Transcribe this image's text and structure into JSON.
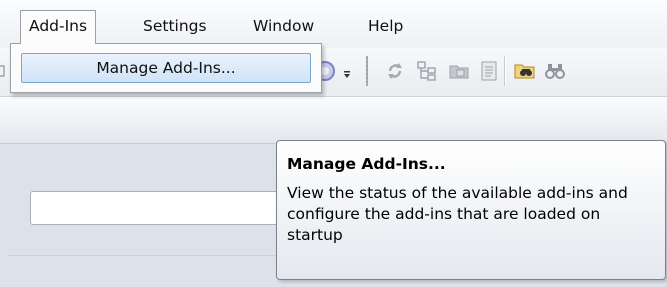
{
  "menubar": {
    "items": [
      {
        "label": "Add-Ins",
        "open": true
      },
      {
        "label": "Settings"
      },
      {
        "label": "Window"
      },
      {
        "label": "Help"
      }
    ]
  },
  "dropdown": {
    "items": [
      {
        "label": "Manage Add-Ins..."
      }
    ]
  },
  "tooltip": {
    "title": "Manage Add-Ins...",
    "body": "View the status of the available add-ins and configure the add-ins that are loaded on startup"
  },
  "toolbar": {
    "icons": [
      "circle-icon",
      "dropdown-arrow-icon",
      "refresh-icon",
      "hierarchy-icon",
      "folder-icon",
      "document-icon",
      "find-folder-icon",
      "binoculars-icon"
    ]
  },
  "search": {
    "value": ""
  },
  "colors": {
    "menu_highlight_border": "#7aa7d6",
    "menu_highlight_bg": "#cfe3f8",
    "tooltip_border": "#7d8188"
  }
}
